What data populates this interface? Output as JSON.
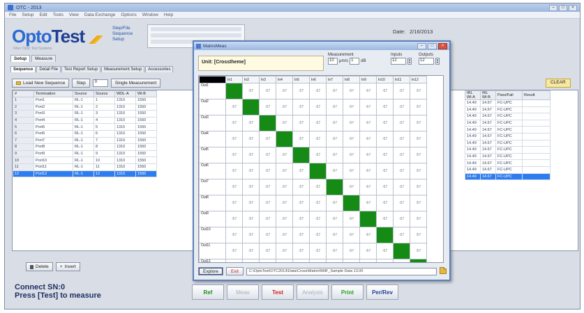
{
  "window": {
    "title": "OTC - 2013"
  },
  "menu": [
    "File",
    "Setup",
    "Edit",
    "Tools",
    "View",
    "Data Exchange",
    "Options",
    "Window",
    "Help"
  ],
  "header": {
    "logo_part1": "Opto",
    "logo_part2": "Test",
    "logo_sub": "Fiber Optic Test Systems",
    "links": [
      "Step/File",
      "Sequence",
      "Setup"
    ],
    "date_label": "Date:",
    "date_value": "2/16/2013"
  },
  "tabs_top": [
    "Setup",
    "Measure"
  ],
  "tabs_sub": [
    "Sequence",
    "Detail File",
    "Test Report Setup",
    "Measurement Setup",
    "Accessories"
  ],
  "toolbar": {
    "load_label": "Load New Sequence",
    "step_label": "Step",
    "step_value": "0",
    "single_label": "Single Measurement",
    "clear_label": "CLEAR"
  },
  "bg_table": {
    "left_headers": [
      "#",
      "Termination",
      "Source",
      "Source",
      "WDL-A",
      "Wl-B"
    ],
    "rows": [
      [
        "1",
        "Port1",
        "RL-1",
        "1",
        "1310",
        "1550"
      ],
      [
        "2",
        "Port2",
        "RL-1",
        "2",
        "1310",
        "1550"
      ],
      [
        "3",
        "Port3",
        "RL-1",
        "3",
        "1310",
        "1550"
      ],
      [
        "4",
        "Port4",
        "RL-1",
        "4",
        "1310",
        "1550"
      ],
      [
        "5",
        "Port5",
        "RL-1",
        "5",
        "1310",
        "1550"
      ],
      [
        "6",
        "Port6",
        "RL-1",
        "6",
        "1310",
        "1550"
      ],
      [
        "7",
        "Port7",
        "RL-1",
        "7",
        "1310",
        "1550"
      ],
      [
        "8",
        "Port8",
        "RL-1",
        "8",
        "1310",
        "1550"
      ],
      [
        "9",
        "Port9",
        "RL-1",
        "9",
        "1310",
        "1550"
      ],
      [
        "10",
        "Port10",
        "RL-1",
        "10",
        "1310",
        "1550"
      ],
      [
        "11",
        "Port11",
        "RL-1",
        "11",
        "1310",
        "1550"
      ],
      [
        "12",
        "Port12",
        "RL-1",
        "12",
        "1310",
        "1550"
      ]
    ],
    "right_headers": [
      "IRL Wl-A",
      "IRL Wl-B",
      "Pass/Fail",
      "Result"
    ],
    "right_rows": [
      [
        "14.49",
        "14.67",
        "FC-UPC",
        ""
      ],
      [
        "14.49",
        "14.67",
        "FC-UPC",
        ""
      ],
      [
        "14.49",
        "14.67",
        "FC-UPC",
        ""
      ],
      [
        "14.49",
        "14.67",
        "FC-UPC",
        ""
      ],
      [
        "14.49",
        "14.67",
        "FC-UPC",
        ""
      ],
      [
        "14.49",
        "14.67",
        "FC-UPC",
        ""
      ],
      [
        "14.49",
        "14.67",
        "FC-UPC",
        ""
      ],
      [
        "14.49",
        "14.67",
        "FC-UPC",
        ""
      ],
      [
        "14.49",
        "14.67",
        "FC-UPC",
        ""
      ],
      [
        "14.49",
        "14.67",
        "FC-UPC",
        ""
      ],
      [
        "14.49",
        "14.67",
        "FC-UPC",
        ""
      ],
      [
        "14.49",
        "14.67",
        "FC-UPC",
        ""
      ]
    ],
    "selected_row": 11
  },
  "bottom_controls": {
    "delete_label": "Delete",
    "insert_label": "Insert"
  },
  "status": {
    "line1": "Connect SN:0",
    "line2": "Press [Test] to measure"
  },
  "actions": [
    {
      "label": "Ref",
      "style": "ref"
    },
    {
      "label": "Meas",
      "style": "dim"
    },
    {
      "label": "Test",
      "style": "test"
    },
    {
      "label": "Analysis",
      "style": "dim"
    },
    {
      "label": "Print",
      "style": "print"
    },
    {
      "label": "Per/Rev",
      "style": "perrev"
    }
  ],
  "modal": {
    "title": "MatrixMeas",
    "unit_label": "Unit: [Crosstheme]",
    "measurement_label": "Measurement",
    "measurement_value": "10",
    "measurement_unit": "μm/s",
    "measurement_value2": "1",
    "measurement_unit2": "dB",
    "inputs_label": "Inputs",
    "inputs_value": "12",
    "outputs_label": "Outputs",
    "outputs_value": "12",
    "col_headers": [
      "In1",
      "In2",
      "In3",
      "In4",
      "In5",
      "In6",
      "In7",
      "In8",
      "In9",
      "In10",
      "In11",
      "In12"
    ],
    "row_headers": [
      "Out1",
      "Out2",
      "Out3",
      "Out4",
      "Out5",
      "Out6",
      "Out7",
      "Out8",
      "Out9",
      "Out10",
      "Out11",
      "Out12"
    ],
    "cell_value": "-57",
    "explore_label": "Explore",
    "exit_label": "Exit",
    "path": "C:\\OptoTest\\OTC2013\\Data\\Cross\\Matrix\\NMF_Sample Data 13.00"
  },
  "colors": {
    "diag": "#158a15",
    "selection": "#2e7df0",
    "accent": "#2c6ad1"
  }
}
